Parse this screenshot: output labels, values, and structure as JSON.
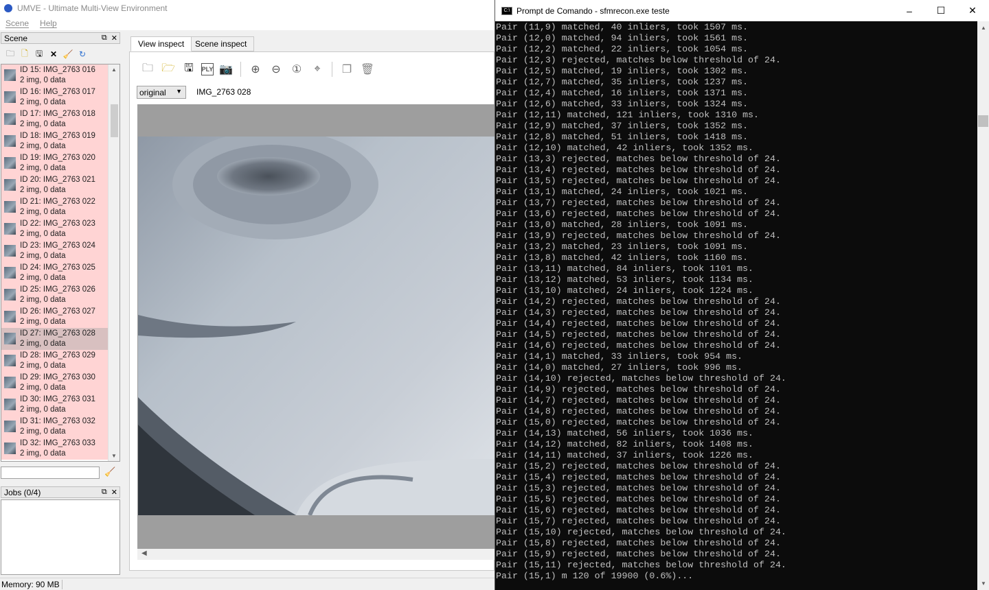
{
  "umve": {
    "title": "UMVE - Ultimate Multi-View Environment",
    "menu": [
      "Scene",
      "Help"
    ],
    "scene_dock_title": "Scene",
    "jobs_dock_title": "Jobs (0/4)",
    "status": "Memory: 90 MB",
    "tabs": [
      "View inspect",
      "Scene inspect"
    ],
    "embedding_select": "original",
    "current_image": "IMG_2763 028",
    "scene_items": [
      {
        "line1": "ID 15: IMG_2763 016",
        "line2": "2 img, 0 data"
      },
      {
        "line1": "ID 16: IMG_2763 017",
        "line2": "2 img, 0 data"
      },
      {
        "line1": "ID 17: IMG_2763 018",
        "line2": "2 img, 0 data"
      },
      {
        "line1": "ID 18: IMG_2763 019",
        "line2": "2 img, 0 data"
      },
      {
        "line1": "ID 19: IMG_2763 020",
        "line2": "2 img, 0 data"
      },
      {
        "line1": "ID 20: IMG_2763 021",
        "line2": "2 img, 0 data"
      },
      {
        "line1": "ID 21: IMG_2763 022",
        "line2": "2 img, 0 data"
      },
      {
        "line1": "ID 22: IMG_2763 023",
        "line2": "2 img, 0 data"
      },
      {
        "line1": "ID 23: IMG_2763 024",
        "line2": "2 img, 0 data"
      },
      {
        "line1": "ID 24: IMG_2763 025",
        "line2": "2 img, 0 data"
      },
      {
        "line1": "ID 25: IMG_2763 026",
        "line2": "2 img, 0 data"
      },
      {
        "line1": "ID 26: IMG_2763 027",
        "line2": "2 img, 0 data"
      },
      {
        "line1": "ID 27: IMG_2763 028",
        "line2": "2 img, 0 data"
      },
      {
        "line1": "ID 28: IMG_2763 029",
        "line2": "2 img, 0 data"
      },
      {
        "line1": "ID 29: IMG_2763 030",
        "line2": "2 img, 0 data"
      },
      {
        "line1": "ID 30: IMG_2763 031",
        "line2": "2 img, 0 data"
      },
      {
        "line1": "ID 31: IMG_2763 032",
        "line2": "2 img, 0 data"
      },
      {
        "line1": "ID 32: IMG_2763 033",
        "line2": "2 img, 0 data"
      }
    ],
    "selected_index": 12
  },
  "cmd": {
    "title": "Prompt de Comando - sfmrecon.exe  teste",
    "lines": [
      "Pair (11,9) matched, 40 inliers, took 1507 ms.",
      "Pair (12,0) matched, 94 inliers, took 1561 ms.",
      "Pair (12,2) matched, 22 inliers, took 1054 ms.",
      "Pair (12,3) rejected, matches below threshold of 24.",
      "Pair (12,5) matched, 19 inliers, took 1302 ms.",
      "Pair (12,7) matched, 35 inliers, took 1237 ms.",
      "Pair (12,4) matched, 16 inliers, took 1371 ms.",
      "Pair (12,6) matched, 33 inliers, took 1324 ms.",
      "Pair (12,11) matched, 121 inliers, took 1310 ms.",
      "Pair (12,9) matched, 37 inliers, took 1352 ms.",
      "Pair (12,8) matched, 51 inliers, took 1418 ms.",
      "Pair (12,10) matched, 42 inliers, took 1352 ms.",
      "Pair (13,3) rejected, matches below threshold of 24.",
      "Pair (13,4) rejected, matches below threshold of 24.",
      "Pair (13,5) rejected, matches below threshold of 24.",
      "Pair (13,1) matched, 24 inliers, took 1021 ms.",
      "Pair (13,7) rejected, matches below threshold of 24.",
      "Pair (13,6) rejected, matches below threshold of 24.",
      "Pair (13,0) matched, 28 inliers, took 1091 ms.",
      "Pair (13,9) rejected, matches below threshold of 24.",
      "Pair (13,2) matched, 23 inliers, took 1091 ms.",
      "Pair (13,8) matched, 42 inliers, took 1160 ms.",
      "Pair (13,11) matched, 84 inliers, took 1101 ms.",
      "Pair (13,12) matched, 53 inliers, took 1134 ms.",
      "Pair (13,10) matched, 24 inliers, took 1224 ms.",
      "Pair (14,2) rejected, matches below threshold of 24.",
      "Pair (14,3) rejected, matches below threshold of 24.",
      "Pair (14,4) rejected, matches below threshold of 24.",
      "Pair (14,5) rejected, matches below threshold of 24.",
      "Pair (14,6) rejected, matches below threshold of 24.",
      "Pair (14,1) matched, 33 inliers, took 954 ms.",
      "Pair (14,0) matched, 27 inliers, took 996 ms.",
      "Pair (14,10) rejected, matches below threshold of 24.",
      "Pair (14,9) rejected, matches below threshold of 24.",
      "Pair (14,7) rejected, matches below threshold of 24.",
      "Pair (14,8) rejected, matches below threshold of 24.",
      "Pair (15,0) rejected, matches below threshold of 24.",
      "Pair (14,13) matched, 56 inliers, took 1036 ms.",
      "Pair (14,12) matched, 82 inliers, took 1408 ms.",
      "Pair (14,11) matched, 37 inliers, took 1226 ms.",
      "Pair (15,2) rejected, matches below threshold of 24.",
      "Pair (15,4) rejected, matches below threshold of 24.",
      "Pair (15,3) rejected, matches below threshold of 24.",
      "Pair (15,5) rejected, matches below threshold of 24.",
      "Pair (15,6) rejected, matches below threshold of 24.",
      "Pair (15,7) rejected, matches below threshold of 24.",
      "Pair (15,10) rejected, matches below threshold of 24.",
      "Pair (15,8) rejected, matches below threshold of 24.",
      "Pair (15,9) rejected, matches below threshold of 24.",
      "Pair (15,11) rejected, matches below threshold of 24.",
      "Pair (15,1) m 120 of 19900 (0.6%)..."
    ]
  },
  "icons": {
    "scene_toolbar": [
      "open-folder-icon",
      "new-file-icon",
      "save-icon",
      "close-icon",
      "clean-icon",
      "reload-icon"
    ],
    "view_toolbar": [
      "open-icon",
      "open-folder-icon",
      "save-icon",
      "export-ply-icon",
      "screenshot-icon",
      "zoom-in-icon",
      "zoom-out-icon",
      "zoom-reset-icon",
      "zoom-fit-icon",
      "copy-icon",
      "delete-icon"
    ]
  }
}
